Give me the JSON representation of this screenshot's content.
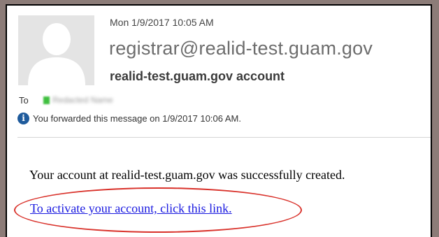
{
  "message": {
    "date": "Mon 1/9/2017 10:05 AM",
    "sender": "registrar@realid-test.guam.gov",
    "account_line": "realid-test.guam.gov account",
    "to_label": "To",
    "recipient_name": "Redacted Name",
    "forwarded_notice": "You forwarded this message on 1/9/2017 10:06 AM.",
    "info_icon": "info-icon",
    "avatar_icon": "person-silhouette"
  },
  "body": {
    "text": "Your account at realid-test.guam.gov was successfully created.",
    "link_text": "To activate your account, click this link."
  },
  "colors": {
    "link": "#1a1ae0",
    "highlight": "#d9322b",
    "sender": "#6d6d6d",
    "info_icon": "#1f5b9c",
    "presence": "#3fbf3f"
  }
}
